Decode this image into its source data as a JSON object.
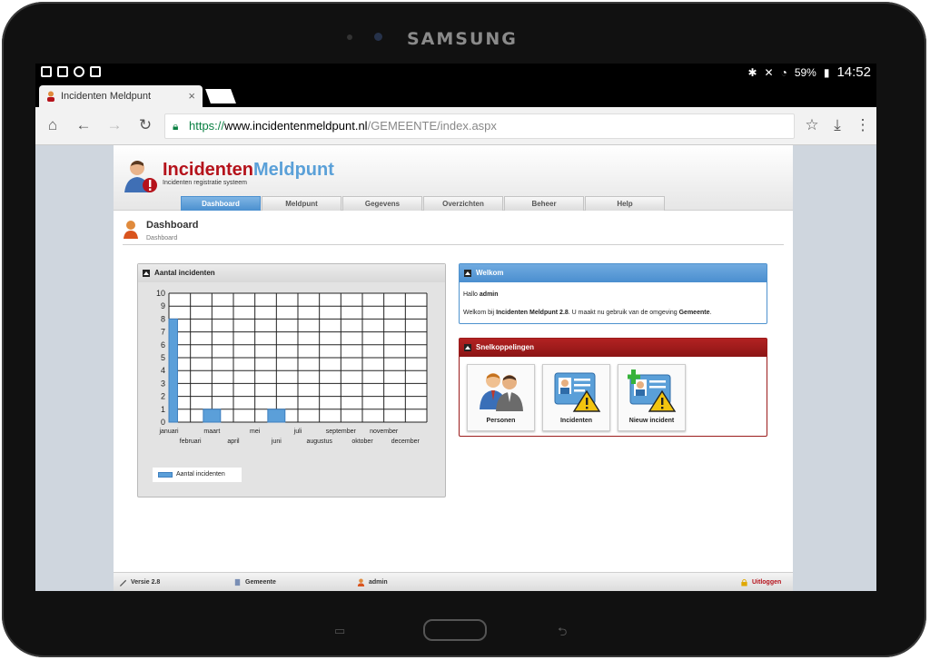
{
  "device": {
    "brand": "SAMSUNG"
  },
  "statusbar": {
    "battery": "59%",
    "time": "14:52"
  },
  "browser": {
    "tab_title": "Incidenten Meldpunt",
    "tab_close": "×",
    "url_scheme": "https://",
    "url_host": "www.incidentenmeldpunt.nl",
    "url_path": "/GEMEENTE/index.aspx"
  },
  "app": {
    "logo_part1": "Incidenten",
    "logo_part2": "Meldpunt",
    "logo_subtitle": "Incidenten registratie systeem",
    "nav": [
      "Dashboard",
      "Meldpunt",
      "Gegevens",
      "Overzichten",
      "Beheer",
      "Help"
    ],
    "active_nav": 0,
    "page_title": "Dashboard",
    "breadcrumb": "Dashboard"
  },
  "chart_panel": {
    "title": "Aantal incidenten",
    "legend": "Aantal incidenten"
  },
  "chart_data": {
    "type": "bar",
    "categories": [
      "januari",
      "februari",
      "maart",
      "april",
      "mei",
      "juni",
      "juli",
      "augustus",
      "september",
      "oktober",
      "november",
      "december"
    ],
    "series": [
      {
        "name": "Aantal incidenten",
        "values": [
          8,
          0,
          1,
          0,
          0,
          1,
          0,
          0,
          0,
          0,
          0,
          0
        ]
      }
    ],
    "ylim": [
      0,
      10
    ],
    "yticks": [
      0,
      1,
      2,
      3,
      4,
      5,
      6,
      7,
      8,
      9,
      10
    ],
    "grid": true,
    "legend_position": "bottom-left",
    "color": "#5b9fd9"
  },
  "welkom": {
    "title": "Welkom",
    "greeting": "Hallo",
    "user": "admin",
    "line_pre": "Welkom bij",
    "product": "Incidenten Meldpunt 2.8",
    "line_mid": ". U maakt nu gebruik van de omgeving",
    "environment": "Gemeente",
    "line_end": "."
  },
  "snel": {
    "title": "Snelkoppelingen",
    "tiles": [
      "Personen",
      "Incidenten",
      "Nieuw incident"
    ]
  },
  "footer": {
    "version": "Versie 2.8",
    "environment": "Gemeente",
    "user": "admin",
    "logout": "Uitloggen"
  }
}
